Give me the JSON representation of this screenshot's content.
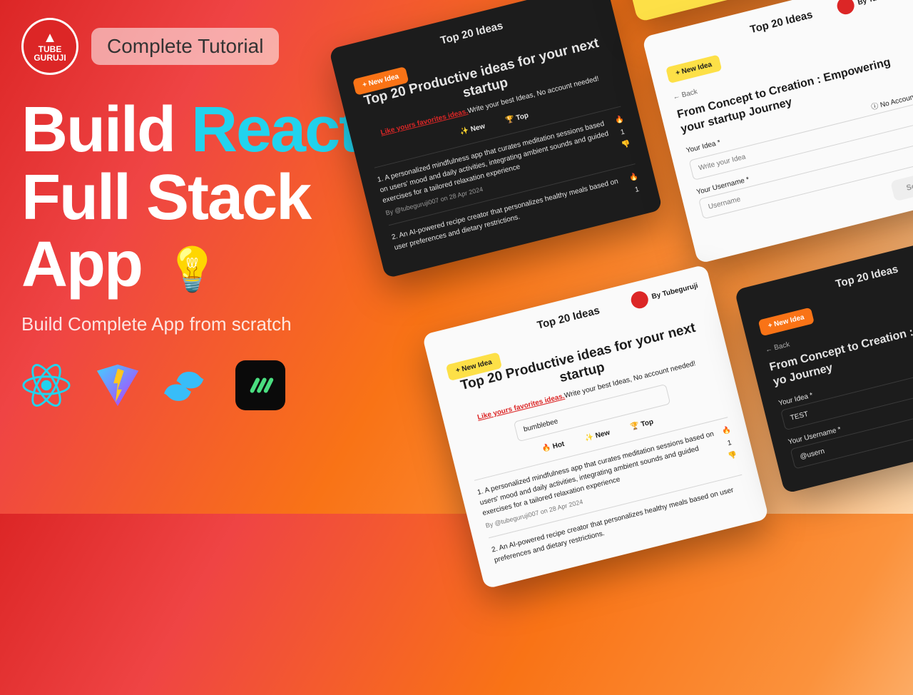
{
  "logo": {
    "line1": "TUBE",
    "line2": "GURUJI"
  },
  "tutorial_badge": "Complete Tutorial",
  "title": {
    "pre": "Build ",
    "react": "React",
    "rest1": "Full Stack",
    "rest2": "App"
  },
  "subtitle": "Build Complete App from scratch",
  "cards": {
    "top_ideas": "Top 20 Ideas",
    "new_idea": "+ New Idea",
    "heading": "Top 20 Productive ideas for your next startup",
    "subhead_red": "Like yours favorites ideas.",
    "subhead_rest": "Write your best Ideas, No account needed!",
    "theme_bumblebee": "bumblebee",
    "tag_hot": "🔥 Hot",
    "tag_new": "✨ New",
    "tag_top": "🏆 Top",
    "idea1": "1. A personalized mindfulness app that curates meditation sessions based on users' mood and daily activities, integrating ambient sounds and guided exercises for a tailored relaxation experience",
    "idea2": "2. An AI-powered recipe creator that personalizes healthy meals based on user preferences and dietary restrictions.",
    "byline": "By @tubeguruji007 on 28 Apr 2024",
    "vote": "1",
    "by_tube": "By Tubeguruji",
    "back": "← Back",
    "form_title": "From Concept to Creation : Empowering your startup Journey",
    "label_idea": "Your Idea *",
    "label_user": "Your Username *",
    "no_account": "ⓘ No Account Ne",
    "placeholder_idea": "Write your Idea",
    "placeholder_user": "Username",
    "value_test": "TEST",
    "value_user": "@usern",
    "send": "Send ➤",
    "form_title_short": "From Concept to Creation : Empowering yo Journey"
  }
}
